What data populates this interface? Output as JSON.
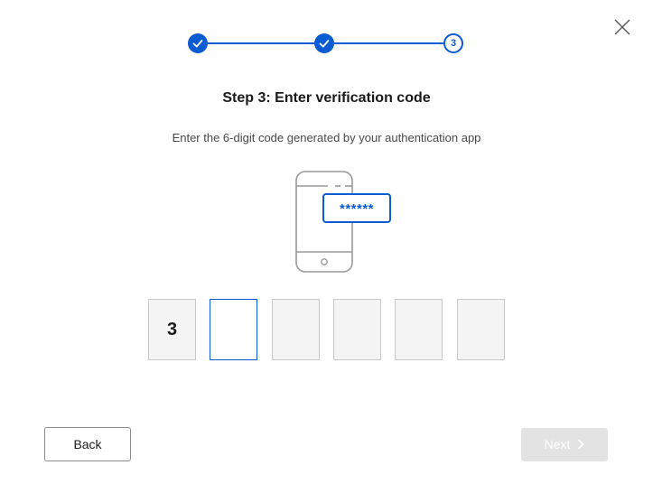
{
  "dialog": {
    "close_icon": "close-icon"
  },
  "stepper": {
    "steps": [
      {
        "state": "completed",
        "icon": "check-icon"
      },
      {
        "state": "completed",
        "icon": "check-icon"
      },
      {
        "state": "current",
        "label": "3"
      }
    ],
    "accent_color": "#0b5bd3"
  },
  "content": {
    "title": "Step 3: Enter verification code",
    "subtitle": "Enter the 6-digit code generated by your authentication app",
    "illustration": {
      "icon": "phone-password-icon",
      "masked_code": "******"
    }
  },
  "code_input": {
    "digits": [
      "3",
      "",
      "",
      "",
      "",
      ""
    ],
    "active_index": 1
  },
  "footer": {
    "back_label": "Back",
    "next_label": "Next",
    "next_disabled": true
  }
}
